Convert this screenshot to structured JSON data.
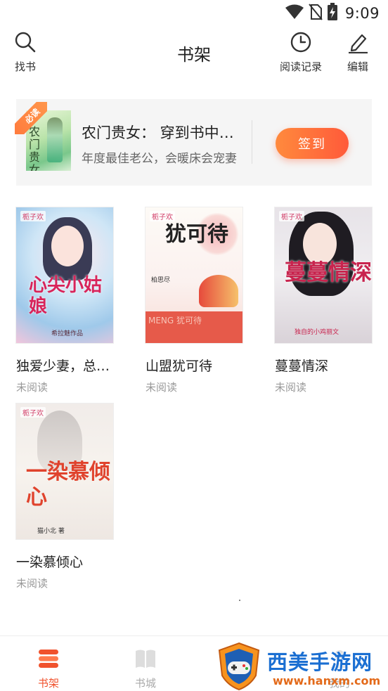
{
  "status_bar": {
    "time": "9:09",
    "icons": [
      "wifi-icon",
      "no-sim-icon",
      "battery-charging-icon"
    ]
  },
  "header": {
    "title": "书架",
    "search_label": "找书",
    "history_label": "阅读记录",
    "edit_label": "编辑"
  },
  "recommend": {
    "badge": "必读",
    "cover_text": "农门贵女",
    "title": "农门贵女： 穿到书中来当女主",
    "subtitle": "年度最佳老公，会暖床会宠妻",
    "checkin_label": "签到"
  },
  "books": [
    {
      "title": "独爱少妻，总裁的心尖小姑娘",
      "status": "未阅读",
      "cover": {
        "publisher": "栀子欢",
        "text": "心尖小姑娘",
        "author": "希拉魅作品"
      }
    },
    {
      "title": "山盟犹可待",
      "status": "未阅读",
      "cover": {
        "publisher": "栀子欢",
        "text": "犹可待",
        "author": "柏思尽",
        "band": "MENG 犹可待"
      }
    },
    {
      "title": "蔓蔓情深",
      "status": "未阅读",
      "cover": {
        "publisher": "栀子欢",
        "text": "蔓蔓情深",
        "author": "独自的小鸡丽文"
      }
    },
    {
      "title": "一染慕倾心",
      "status": "未阅读",
      "cover": {
        "publisher": "栀子欢",
        "text": "一染慕倾心",
        "author": "猫小北 著"
      }
    }
  ],
  "bottom_nav": {
    "shelf_label": "书架",
    "store_label": "书城",
    "mine_label": "我的"
  },
  "watermark": {
    "text": "西美手游网",
    "url": "www.hanxm.com"
  },
  "colors": {
    "accent": "#f0522d",
    "checkin_gradient_start": "#ff8a3d",
    "checkin_gradient_end": "#ff5a3a",
    "inactive_nav": "#aaaaaa",
    "watermark_blue": "#1b6fd2",
    "watermark_orange": "#e36a1a"
  }
}
